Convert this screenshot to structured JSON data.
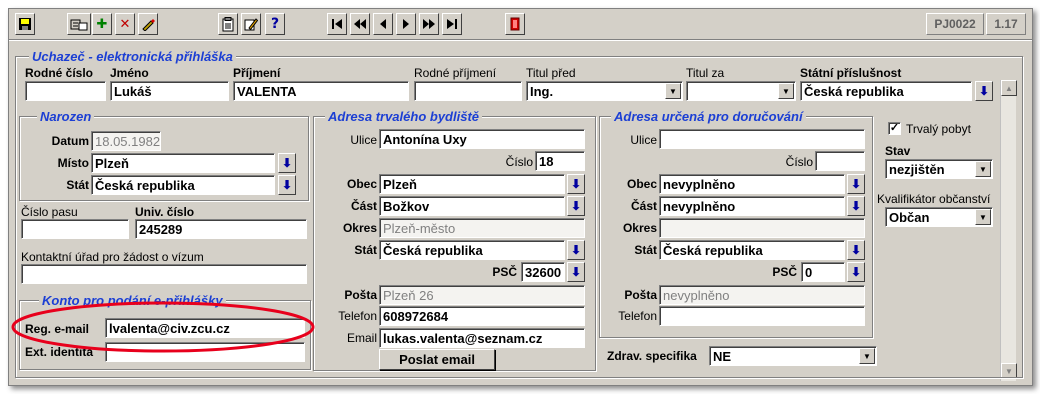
{
  "toolbar": {
    "icons": [
      "save-icon",
      "new-record-icon",
      "add-icon",
      "delete-icon",
      "edit-icon",
      "clipboard-icon",
      "pencil-icon",
      "help-icon",
      "first-record-icon",
      "previous-page-icon",
      "previous-record-icon",
      "next-record-icon",
      "next-page-icon",
      "last-record-icon",
      "exit-icon"
    ],
    "help_glyph": "?",
    "form_code": "PJ0022",
    "version": "1.17"
  },
  "form": {
    "title": "Uchazeč - elektronická přihláška",
    "labels": {
      "rodne_cislo": "Rodné číslo",
      "jmeno": "Jméno",
      "prijmeni": "Příjmení",
      "rodne_prijmeni": "Rodné příjmení",
      "titul_pred": "Titul před",
      "titul_za": "Titul za",
      "statni_prislusnost": "Státní příslušnost"
    },
    "values": {
      "rodne_cislo": "",
      "jmeno": "Lukáš",
      "prijmeni": "VALENTA",
      "rodne_prijmeni": "",
      "titul_pred": "Ing.",
      "titul_za": "",
      "statni_prislusnost": "Česká republika"
    }
  },
  "narozen": {
    "title": "Narozen",
    "datum_label": "Datum",
    "datum": "18.05.1982",
    "misto_label": "Místo",
    "misto": "Plzeň",
    "stat_label": "Stát",
    "stat": "Česká republika"
  },
  "pas": {
    "cislo_pasu_label": "Číslo pasu",
    "cislo_pasu": "",
    "univ_cislo_label": "Univ. číslo",
    "univ_cislo": "245289",
    "urad_label": "Kontaktní úřad pro žádost o vízum",
    "urad": ""
  },
  "konto": {
    "title": "Konto pro podání e-přihlášky",
    "reg_email_label": "Reg. e-mail",
    "reg_email": "lvalenta@civ.zcu.cz",
    "ext_identita_label": "Ext. identita",
    "ext_identita": ""
  },
  "trvale": {
    "title": "Adresa trvalého bydliště",
    "ulice_label": "Ulice",
    "ulice": "Antonína Uxy",
    "cislo_label": "Číslo",
    "cislo": "18",
    "obec_label": "Obec",
    "obec": "Plzeň",
    "cast_label": "Část",
    "cast": "Božkov",
    "okres_label": "Okres",
    "okres": "Plzeň-město",
    "stat_label": "Stát",
    "stat": "Česká republika",
    "psc_label": "PSČ",
    "psc": "32600",
    "posta_label": "Pošta",
    "posta": "Plzeň 26",
    "telefon_label": "Telefon",
    "telefon": "608972684",
    "email_label": "Email",
    "email": "lukas.valenta@seznam.cz",
    "send_email_button": "Poslat email"
  },
  "dorucovaci": {
    "title": "Adresa určená pro doručování",
    "ulice_label": "Ulice",
    "ulice": "",
    "cislo_label": "Číslo",
    "cislo": "",
    "obec_label": "Obec",
    "obec": "nevyplněno",
    "cast_label": "Část",
    "cast": "nevyplněno",
    "okres_label": "Okres",
    "okres": "",
    "stat_label": "Stát",
    "stat": "Česká republika",
    "psc_label": "PSČ",
    "psc": "0",
    "posta_label": "Pošta",
    "posta": "nevyplněno",
    "telefon_label": "Telefon",
    "telefon": ""
  },
  "right": {
    "trvaly_pobyt_label": "Trvalý pobyt",
    "trvaly_pobyt_checked": true,
    "check_mark": "✓",
    "stav_label": "Stav",
    "stav": "nezjištěn",
    "kvalifikator_label": "Kvalifikátor občanství",
    "kvalifikator": "Občan",
    "zdrav_label": "Zdrav. specifika",
    "zdrav": "NE"
  },
  "annotation": {
    "color": "#e8001c"
  }
}
